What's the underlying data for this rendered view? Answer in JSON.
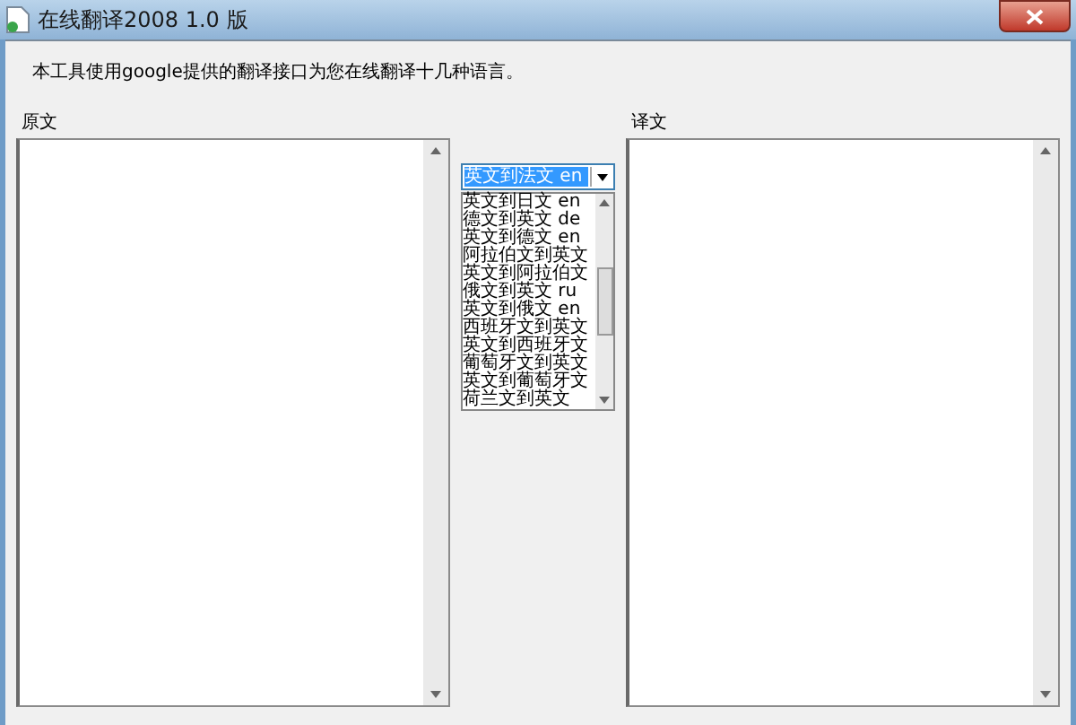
{
  "window": {
    "title": "在线翻译2008 1.0 版"
  },
  "intro": "本工具使用google提供的翻译接口为您在线翻译十几种语言。",
  "source": {
    "label": "原文"
  },
  "target": {
    "label": "译文"
  },
  "language_select": {
    "value": "英文到法文 en",
    "expanded": true,
    "options": [
      {
        "label": "英文到日文 en",
        "selected": false
      },
      {
        "label": "德文到英文 de",
        "selected": false
      },
      {
        "label": "英文到德文 en",
        "selected": false
      },
      {
        "label": "阿拉伯文到英文",
        "selected": false
      },
      {
        "label": "英文到阿拉伯文",
        "selected": false
      },
      {
        "label": "俄文到英文 ru",
        "selected": false
      },
      {
        "label": "英文到俄文 en",
        "selected": false
      },
      {
        "label": "西班牙文到英文",
        "selected": false
      },
      {
        "label": "英文到西班牙文",
        "selected": false
      },
      {
        "label": "葡萄牙文到英文",
        "selected": false
      },
      {
        "label": "英文到葡萄牙文",
        "selected": false
      },
      {
        "label": "荷兰文到英文",
        "selected": false
      }
    ]
  }
}
